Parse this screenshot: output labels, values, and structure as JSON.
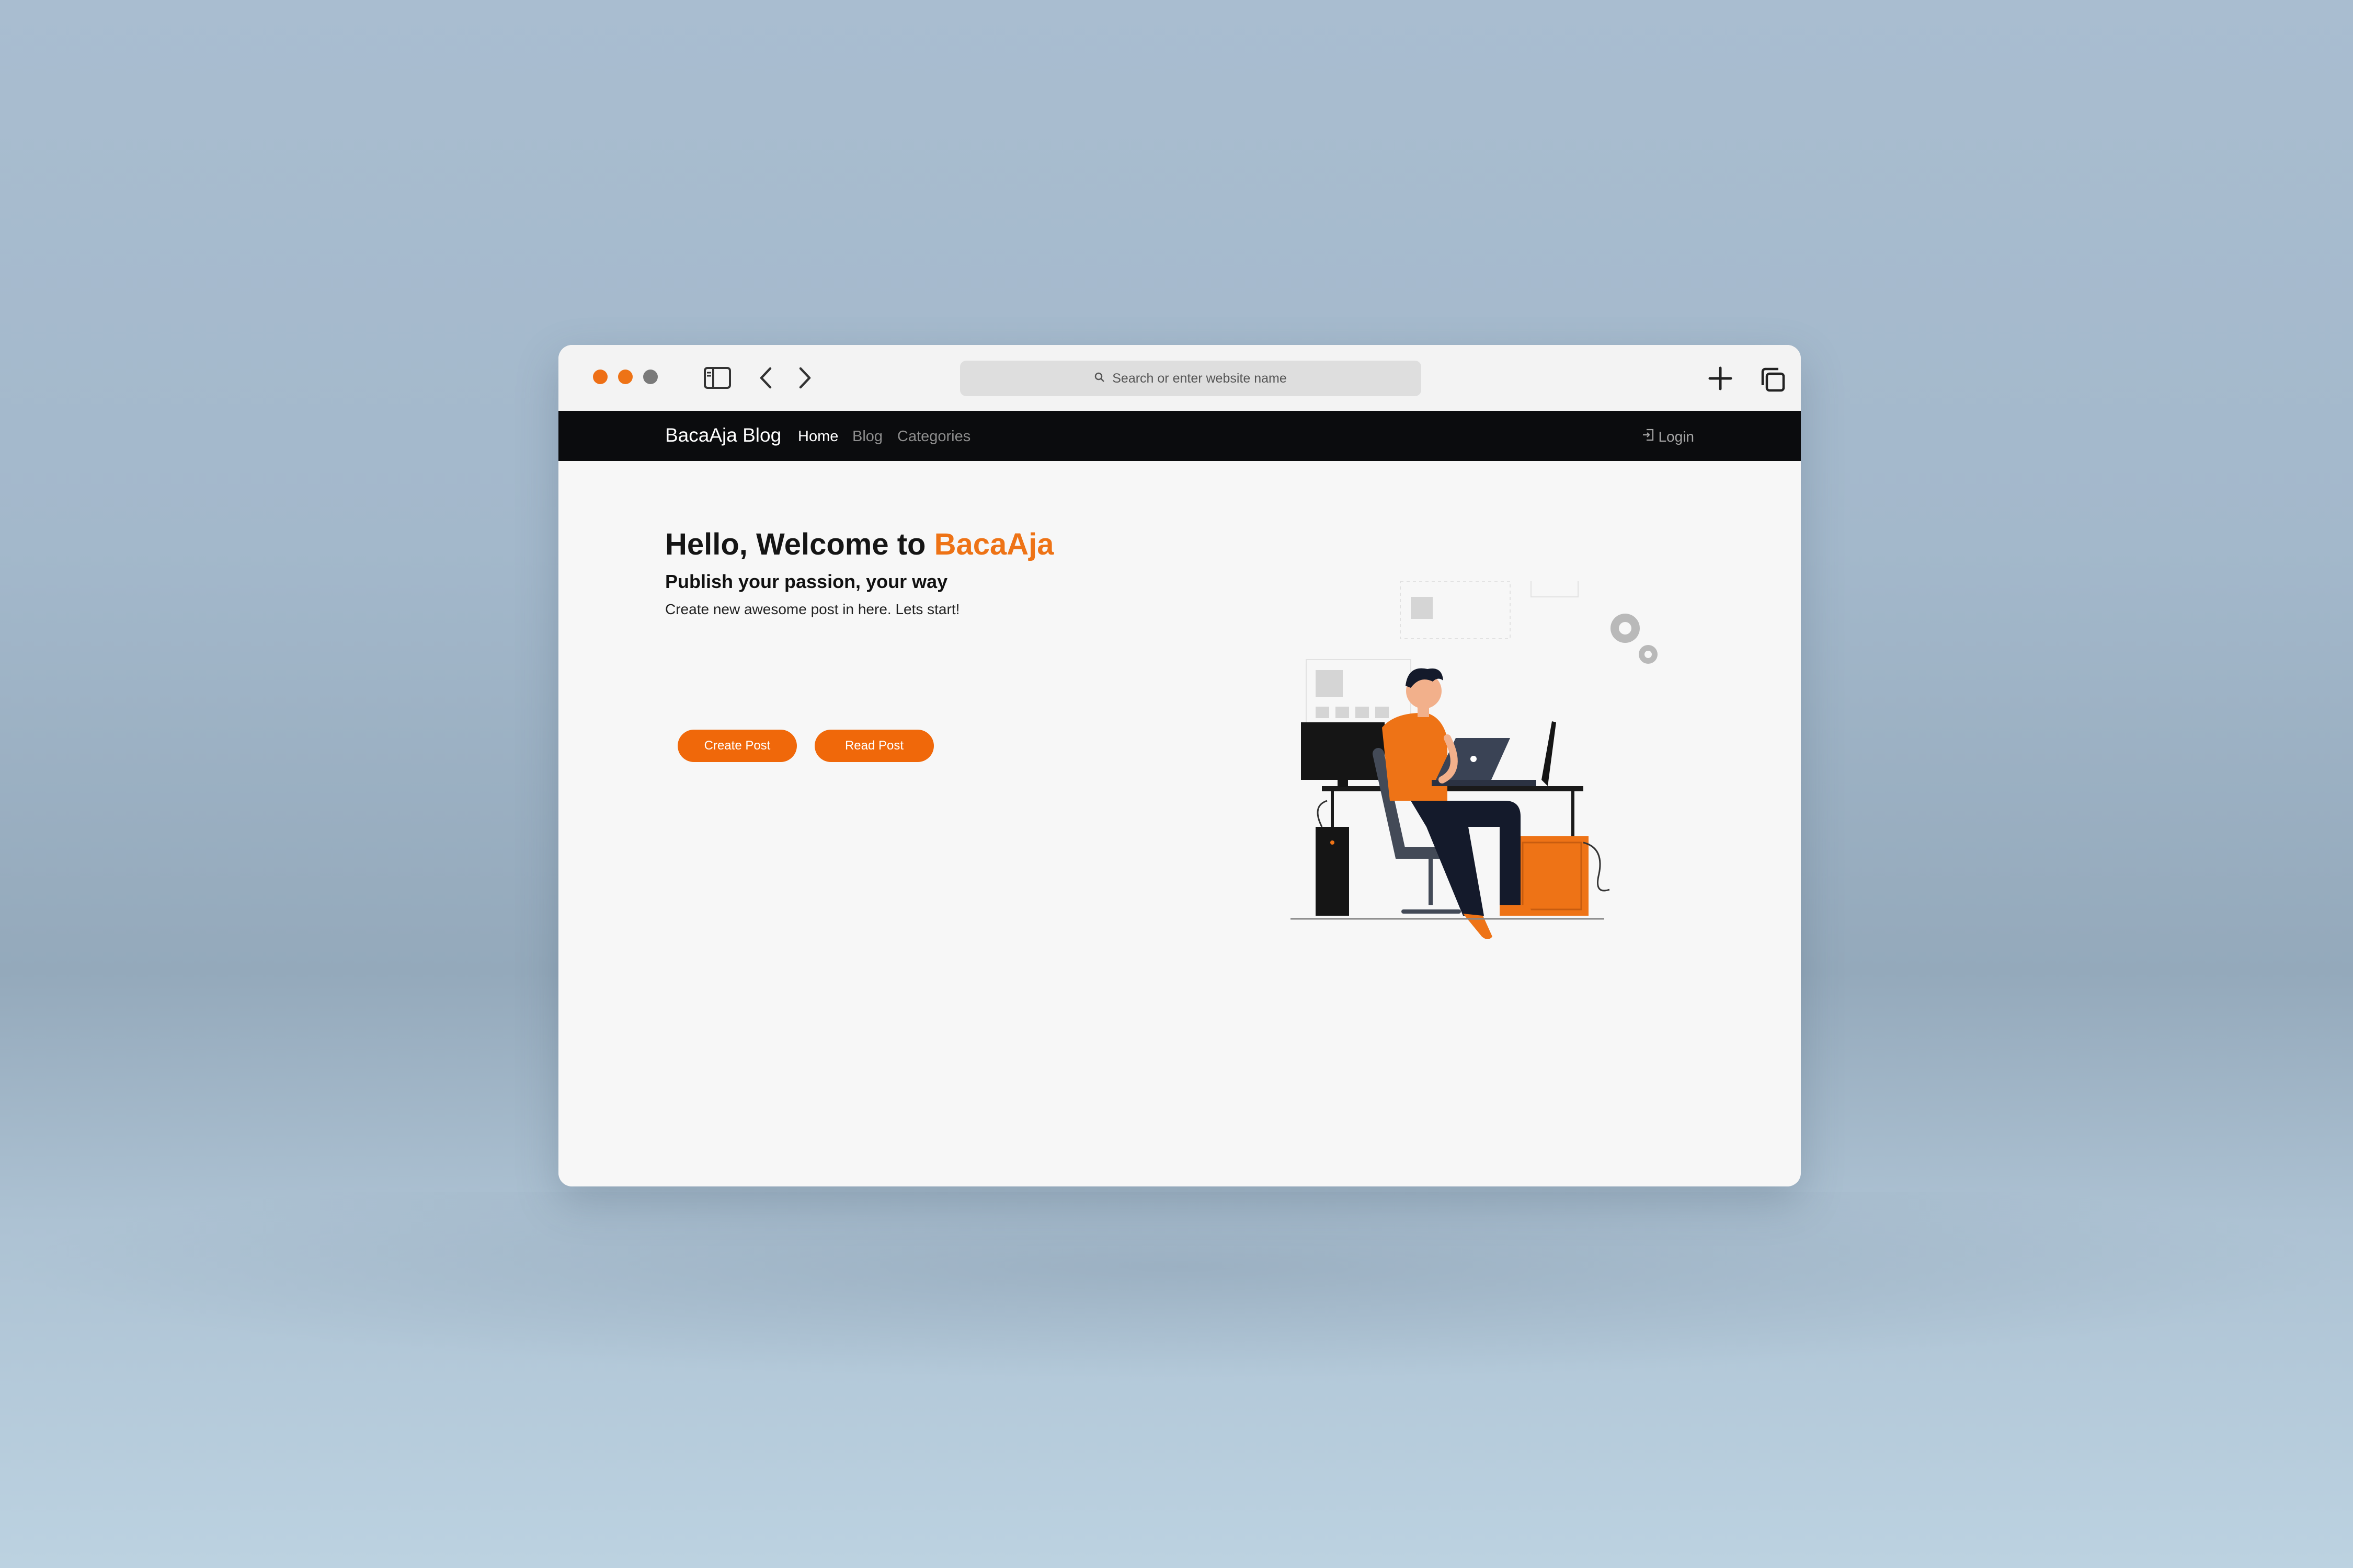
{
  "colors": {
    "accent": "#ee7316",
    "button": "#f0680a",
    "navbar_bg": "#0b0c0e",
    "traffic_red": "#ee6f16",
    "traffic_yellow": "#ee7316",
    "traffic_gray": "#7a7a7a"
  },
  "browser": {
    "address_placeholder": "Search or enter website name",
    "icons": [
      "sidebar-icon",
      "back-icon",
      "forward-icon",
      "search-icon",
      "new-tab-icon",
      "tabs-overview-icon"
    ]
  },
  "navbar": {
    "brand": "BacaAja Blog",
    "links": [
      {
        "label": "Home",
        "active": true
      },
      {
        "label": "Blog",
        "active": false
      },
      {
        "label": "Categories",
        "active": false
      }
    ],
    "login": "Login",
    "login_icon": "login-icon"
  },
  "hero": {
    "title_prefix": "Hello, Welcome to ",
    "title_accent": "BacaAja",
    "subtitle": "Publish your passion, your way",
    "description": "Create new awesome post in here. Lets start!",
    "buttons": {
      "create": "Create Post",
      "read": "Read Post"
    }
  }
}
